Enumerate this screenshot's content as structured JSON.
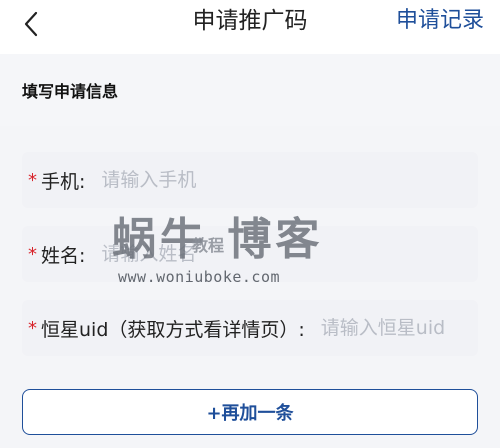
{
  "header": {
    "back_icon": "chevron-left-icon",
    "title": "申请推广码",
    "records_link": "申请记录"
  },
  "section": {
    "title": "填写申请信息"
  },
  "fields": [
    {
      "required_mark": "*",
      "label": "手机:",
      "placeholder": "请输入手机",
      "value": ""
    },
    {
      "required_mark": "*",
      "label": "姓名:",
      "placeholder": "请输入姓名",
      "value": ""
    },
    {
      "required_mark": "*",
      "label": "恒星uid（获取方式看详情页）:",
      "placeholder": "请输入恒星uid",
      "value": ""
    }
  ],
  "add_button": {
    "label": "+再加一条"
  },
  "watermark": {
    "main": "蜗牛 博客",
    "small": "教程",
    "url": "www.woniuboke.com"
  },
  "colors": {
    "accent": "#1f4f9a",
    "required": "#d8242b",
    "field_bg": "#f1f2f6"
  }
}
